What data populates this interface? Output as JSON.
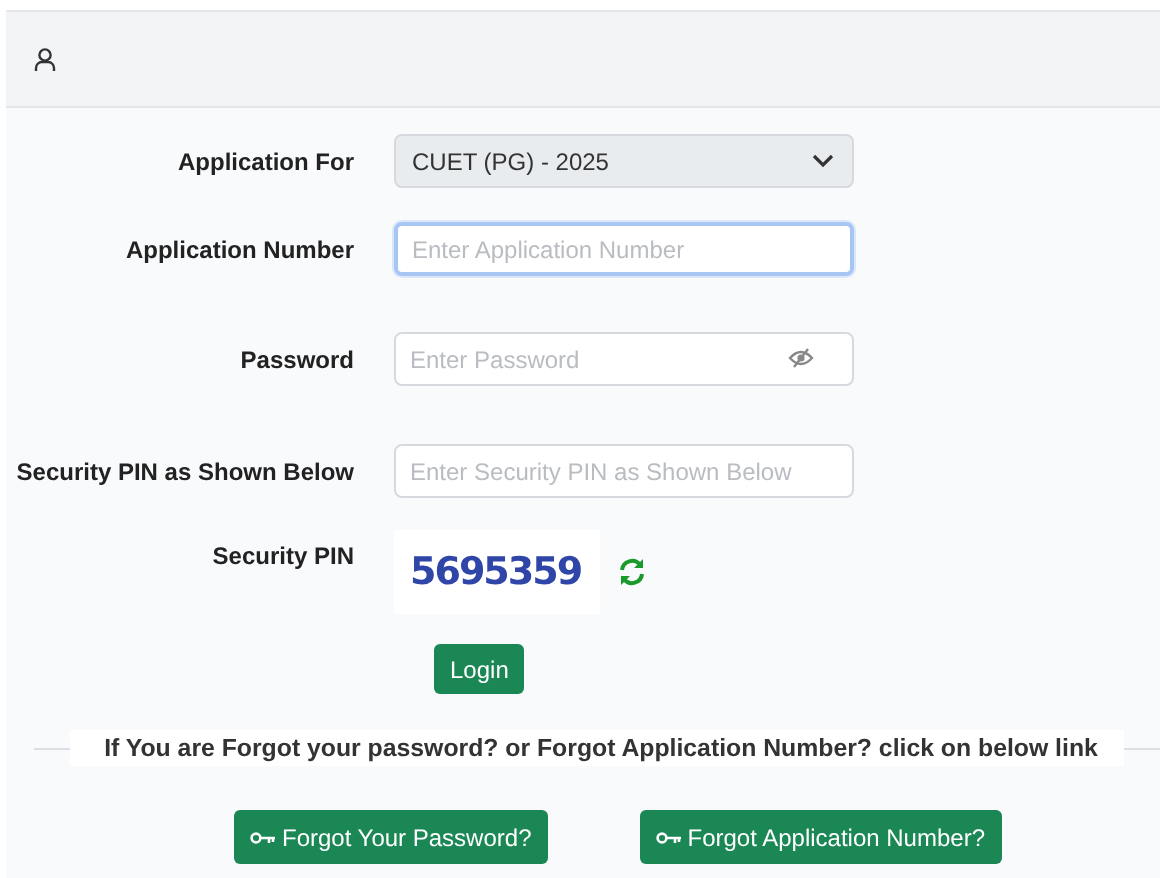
{
  "fields": [
    {
      "kind": "select",
      "label": "Application For",
      "value": "CUET (PG) - 2025"
    },
    {
      "kind": "text",
      "label": "Application Number",
      "placeholder": "Enter Application Number",
      "focused": true
    },
    {
      "kind": "password",
      "label": "Password",
      "placeholder": "Enter Password",
      "focused": false
    },
    {
      "kind": "text",
      "label": "Security PIN as Shown Below",
      "placeholder": "Enter Security PIN as Shown Below",
      "focused": false
    },
    {
      "kind": "captcha",
      "label": "Security PIN",
      "code": "5695359"
    }
  ],
  "login_button": "Login",
  "help_text": "If You are Forgot your password? or Forgot Application Number? click on below link",
  "links": [
    "Forgot Your Password?",
    "Forgot Application Number?"
  ]
}
